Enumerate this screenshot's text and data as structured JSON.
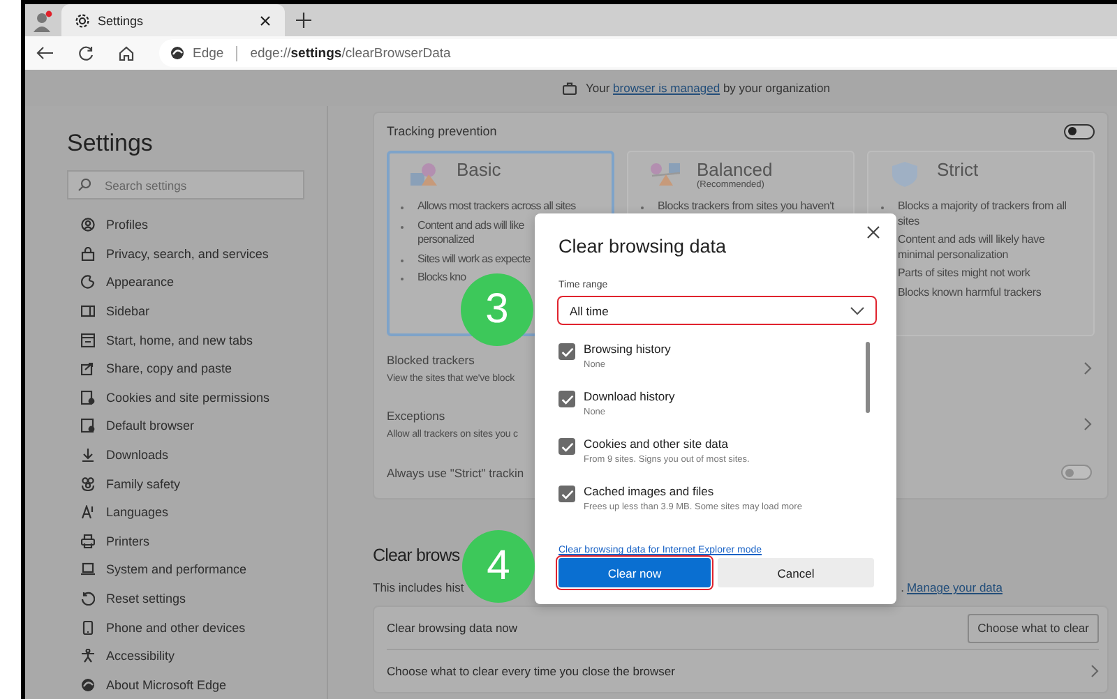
{
  "browser": {
    "tab": {
      "title": "Settings"
    },
    "address": {
      "site": "Edge",
      "url": "edge://**settings**/clearBrowserData"
    }
  },
  "banner": {
    "before": "Your ",
    "link": "browser is managed",
    "after": " by your organization"
  },
  "sidebar": {
    "title": "Settings",
    "search": {
      "placeholder": "Search settings"
    },
    "items": [
      {
        "label": "Profiles"
      },
      {
        "label": "Privacy, search, and services"
      },
      {
        "label": "Appearance"
      },
      {
        "label": "Sidebar"
      },
      {
        "label": "Start, home, and new tabs"
      },
      {
        "label": "Share, copy and paste"
      },
      {
        "label": "Cookies and site permissions"
      },
      {
        "label": "Default browser"
      },
      {
        "label": "Downloads"
      },
      {
        "label": "Family safety"
      },
      {
        "label": "Languages"
      },
      {
        "label": "Printers"
      },
      {
        "label": "System and performance"
      },
      {
        "label": "Reset settings"
      },
      {
        "label": "Phone and other devices"
      },
      {
        "label": "Accessibility"
      },
      {
        "label": "About Microsoft Edge"
      }
    ]
  },
  "tracking": {
    "title": "Tracking prevention",
    "on": false,
    "levels": [
      {
        "title": "Basic",
        "selected": true,
        "bullets": [
          [
            "Allows most trackers across all sites"
          ],
          [
            "Content and ads will like",
            "personalized"
          ],
          [
            "Sites will work as expecte"
          ],
          [
            "Blocks kno"
          ]
        ]
      },
      {
        "title": "Balanced",
        "subtitle": "(Recommended)",
        "selected": false,
        "bullets": [
          [
            "Blocks trackers from sites you haven't"
          ]
        ]
      },
      {
        "title": "Strict",
        "selected": false,
        "bullets": [
          [
            "Blocks a majority of trackers from all",
            "sites"
          ],
          [
            "Content and ads will likely have",
            "minimal personalization"
          ],
          [
            "Parts of sites might not work"
          ],
          [
            "Blocks known harmful trackers"
          ]
        ]
      }
    ],
    "rows": [
      {
        "kind": "link",
        "label": "Blocked trackers",
        "detail": "View the sites that we've block"
      },
      {
        "kind": "link",
        "label": "Exceptions",
        "detail": "Allow all trackers on sites you c"
      },
      {
        "kind": "toggle",
        "label": "Always use \"Strict\" trackin",
        "on": false
      }
    ]
  },
  "clear_section": {
    "heading": "Clear brows",
    "description": "This includes hist",
    "after": ".",
    "link": "Manage your data",
    "rows": [
      {
        "kind": "button",
        "label": "Clear browsing data now",
        "button": "Choose what to clear"
      },
      {
        "kind": "link",
        "label": "Choose what to clear every time you close the browser"
      }
    ]
  },
  "dialog": {
    "title": "Clear browsing data",
    "time_range": {
      "label": "Time range",
      "value": "All time",
      "highlighted": true
    },
    "options": [
      {
        "label": "Browsing history",
        "detail": "None",
        "checked": true
      },
      {
        "label": "Download history",
        "detail": "None",
        "checked": true
      },
      {
        "label": "Cookies and other site data",
        "detail": "From 9 sites. Signs you out of most sites.",
        "checked": true
      },
      {
        "label": "Cached images and files",
        "detail": "Frees up less than 3.9 MB. Some sites may load more",
        "checked": true
      }
    ],
    "ie_link": "Clear browsing data for Internet Explorer mode",
    "buttons": [
      {
        "label": "Clear now",
        "kind": "primary",
        "highlighted": true
      },
      {
        "label": "Cancel",
        "kind": "secondary",
        "highlighted": false
      }
    ]
  },
  "step_badges": [
    {
      "number": "3"
    },
    {
      "number": "4"
    }
  ]
}
